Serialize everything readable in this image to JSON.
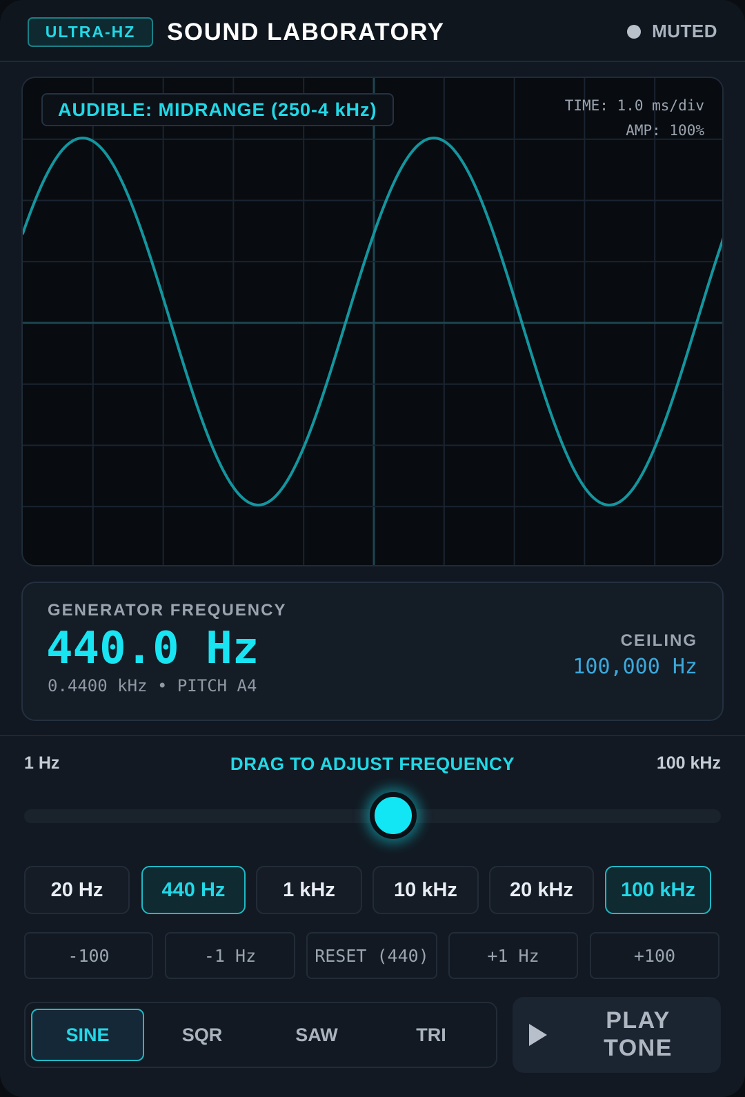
{
  "header": {
    "badge": "ULTRA-HZ",
    "title": "SOUND LABORATORY",
    "status": "MUTED"
  },
  "scope": {
    "band_label": "AUDIBLE: MIDRANGE (250-4 kHz)",
    "time_readout": "TIME: 1.0 ms/div",
    "amp_readout": "AMP: 100%",
    "trace_color": "#14959e",
    "cycles_shown": 2
  },
  "generator": {
    "label": "GENERATOR FREQUENCY",
    "value": "440.0 Hz",
    "sub": "0.4400 kHz • PITCH A4",
    "ceiling_label": "CEILING",
    "ceiling_value": "100,000 Hz"
  },
  "slider": {
    "min_label": "1 Hz",
    "hint": "DRAG TO ADJUST FREQUENCY",
    "max_label": "100 kHz",
    "position": 0.53
  },
  "presets": [
    {
      "label": "20 Hz",
      "active": false
    },
    {
      "label": "440 Hz",
      "active": true
    },
    {
      "label": "1 kHz",
      "active": false
    },
    {
      "label": "10 kHz",
      "active": false
    },
    {
      "label": "20 kHz",
      "active": false
    },
    {
      "label": "100 kHz",
      "active": true
    }
  ],
  "fine_tune": [
    "-100",
    "-1 Hz",
    "RESET (440)",
    "+1 Hz",
    "+100"
  ],
  "waveforms": [
    {
      "label": "SINE",
      "active": true
    },
    {
      "label": "SQR",
      "active": false
    },
    {
      "label": "SAW",
      "active": false
    },
    {
      "label": "TRI",
      "active": false
    }
  ],
  "play": {
    "label_line1": "PLAY",
    "label_line2": "TONE",
    "icon": "play-icon"
  },
  "colors": {
    "accent": "#22d8e6",
    "ceiling": "#3aa8dc"
  }
}
